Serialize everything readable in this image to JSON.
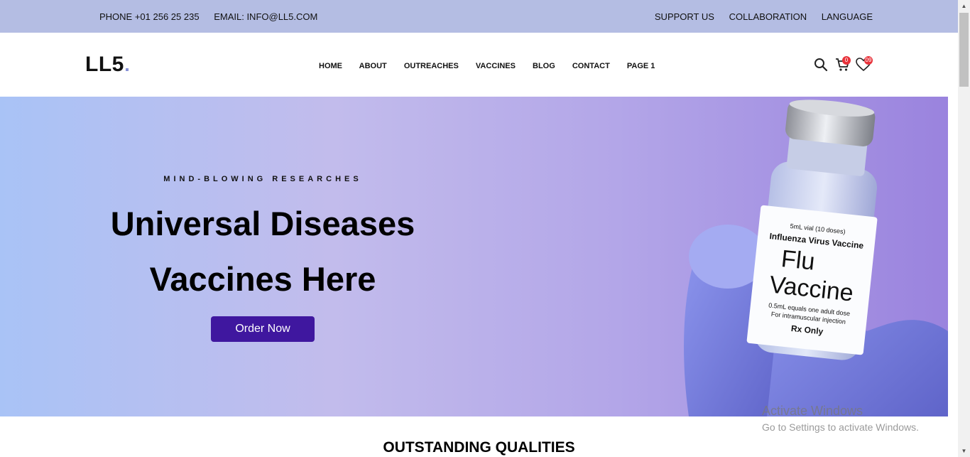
{
  "topbar": {
    "phone": "PHONE +01 256 25 235",
    "email": "EMAIL: INFO@LL5.COM",
    "links": [
      "SUPPORT US",
      "COLLABORATION",
      "LANGUAGE"
    ]
  },
  "nav": {
    "logo": "LL5",
    "menu": [
      "HOME",
      "ABOUT",
      "OUTREACHES",
      "VACCINES",
      "BLOG",
      "CONTACT",
      "PAGE 1"
    ],
    "icons": [
      "search-icon",
      "cart-icon",
      "heart-icon"
    ],
    "cart_count": "0",
    "wishlist_count": "09"
  },
  "hero": {
    "eyebrow": "MIND-BLOWING RESEARCHES",
    "title_line1": "Universal Diseases",
    "title_line2": "Vaccines Here",
    "cta": "Order Now",
    "vial_label": {
      "volume": "5mL vial (10 doses)",
      "product": "Influenza Virus Vaccine",
      "name_line1": "Flu",
      "name_line2": "Vaccine",
      "dose": "0.5mL equals one adult dose",
      "route": "For intramuscular injection",
      "rx": "Rx Only"
    }
  },
  "section": {
    "title": "OUTSTANDING QUALITIES"
  },
  "watermark": {
    "line1": "Activate Windows",
    "line2": "Go to Settings to activate Windows."
  },
  "colors": {
    "topbar_bg": "#b4bde3",
    "cta_bg": "#3f179f",
    "badge": "#e8323a",
    "hero_gradient_start": "#a9c3f6",
    "hero_gradient_end": "#9a83de"
  }
}
